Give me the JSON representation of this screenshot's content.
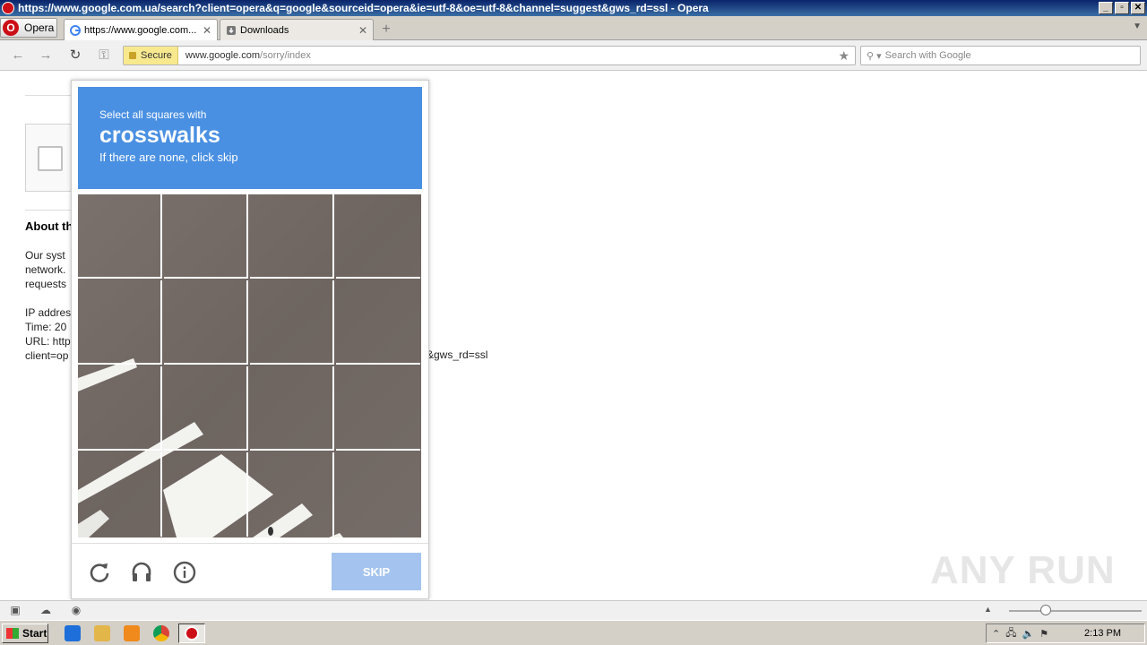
{
  "window": {
    "title": "https://www.google.com.ua/search?client=opera&q=google&sourceid=opera&ie=utf-8&oe=utf-8&channel=suggest&gws_rd=ssl - Opera",
    "min": "_",
    "max": "▫",
    "close": "✕"
  },
  "menu": {
    "label": "Opera"
  },
  "tabs": [
    {
      "label": "https://www.google.com...",
      "close": "✕",
      "active": true
    },
    {
      "label": "Downloads",
      "close": "✕",
      "active": false
    }
  ],
  "address": {
    "secure_label": "Secure",
    "url_host": "www.google.com",
    "url_path": "/sorry/index"
  },
  "search": {
    "placeholder": "Search with Google"
  },
  "page": {
    "about_heading": "About th",
    "body_lines": [
      "Our syst",
      "network.",
      "requests",
      "",
      "IP addres",
      "Time: 20",
      "URL: http",
      "client=op"
    ],
    "tail": "&gws_rd=ssl"
  },
  "captcha": {
    "instruction": "Select all squares with",
    "target": "crosswalks",
    "subtext": "If there are none, click skip",
    "skip_label": "SKIP",
    "header_color": "#4a90e2"
  },
  "watermark": "ANY RUN",
  "taskbar": {
    "start_label": "Start",
    "clock": "2:13 PM"
  }
}
